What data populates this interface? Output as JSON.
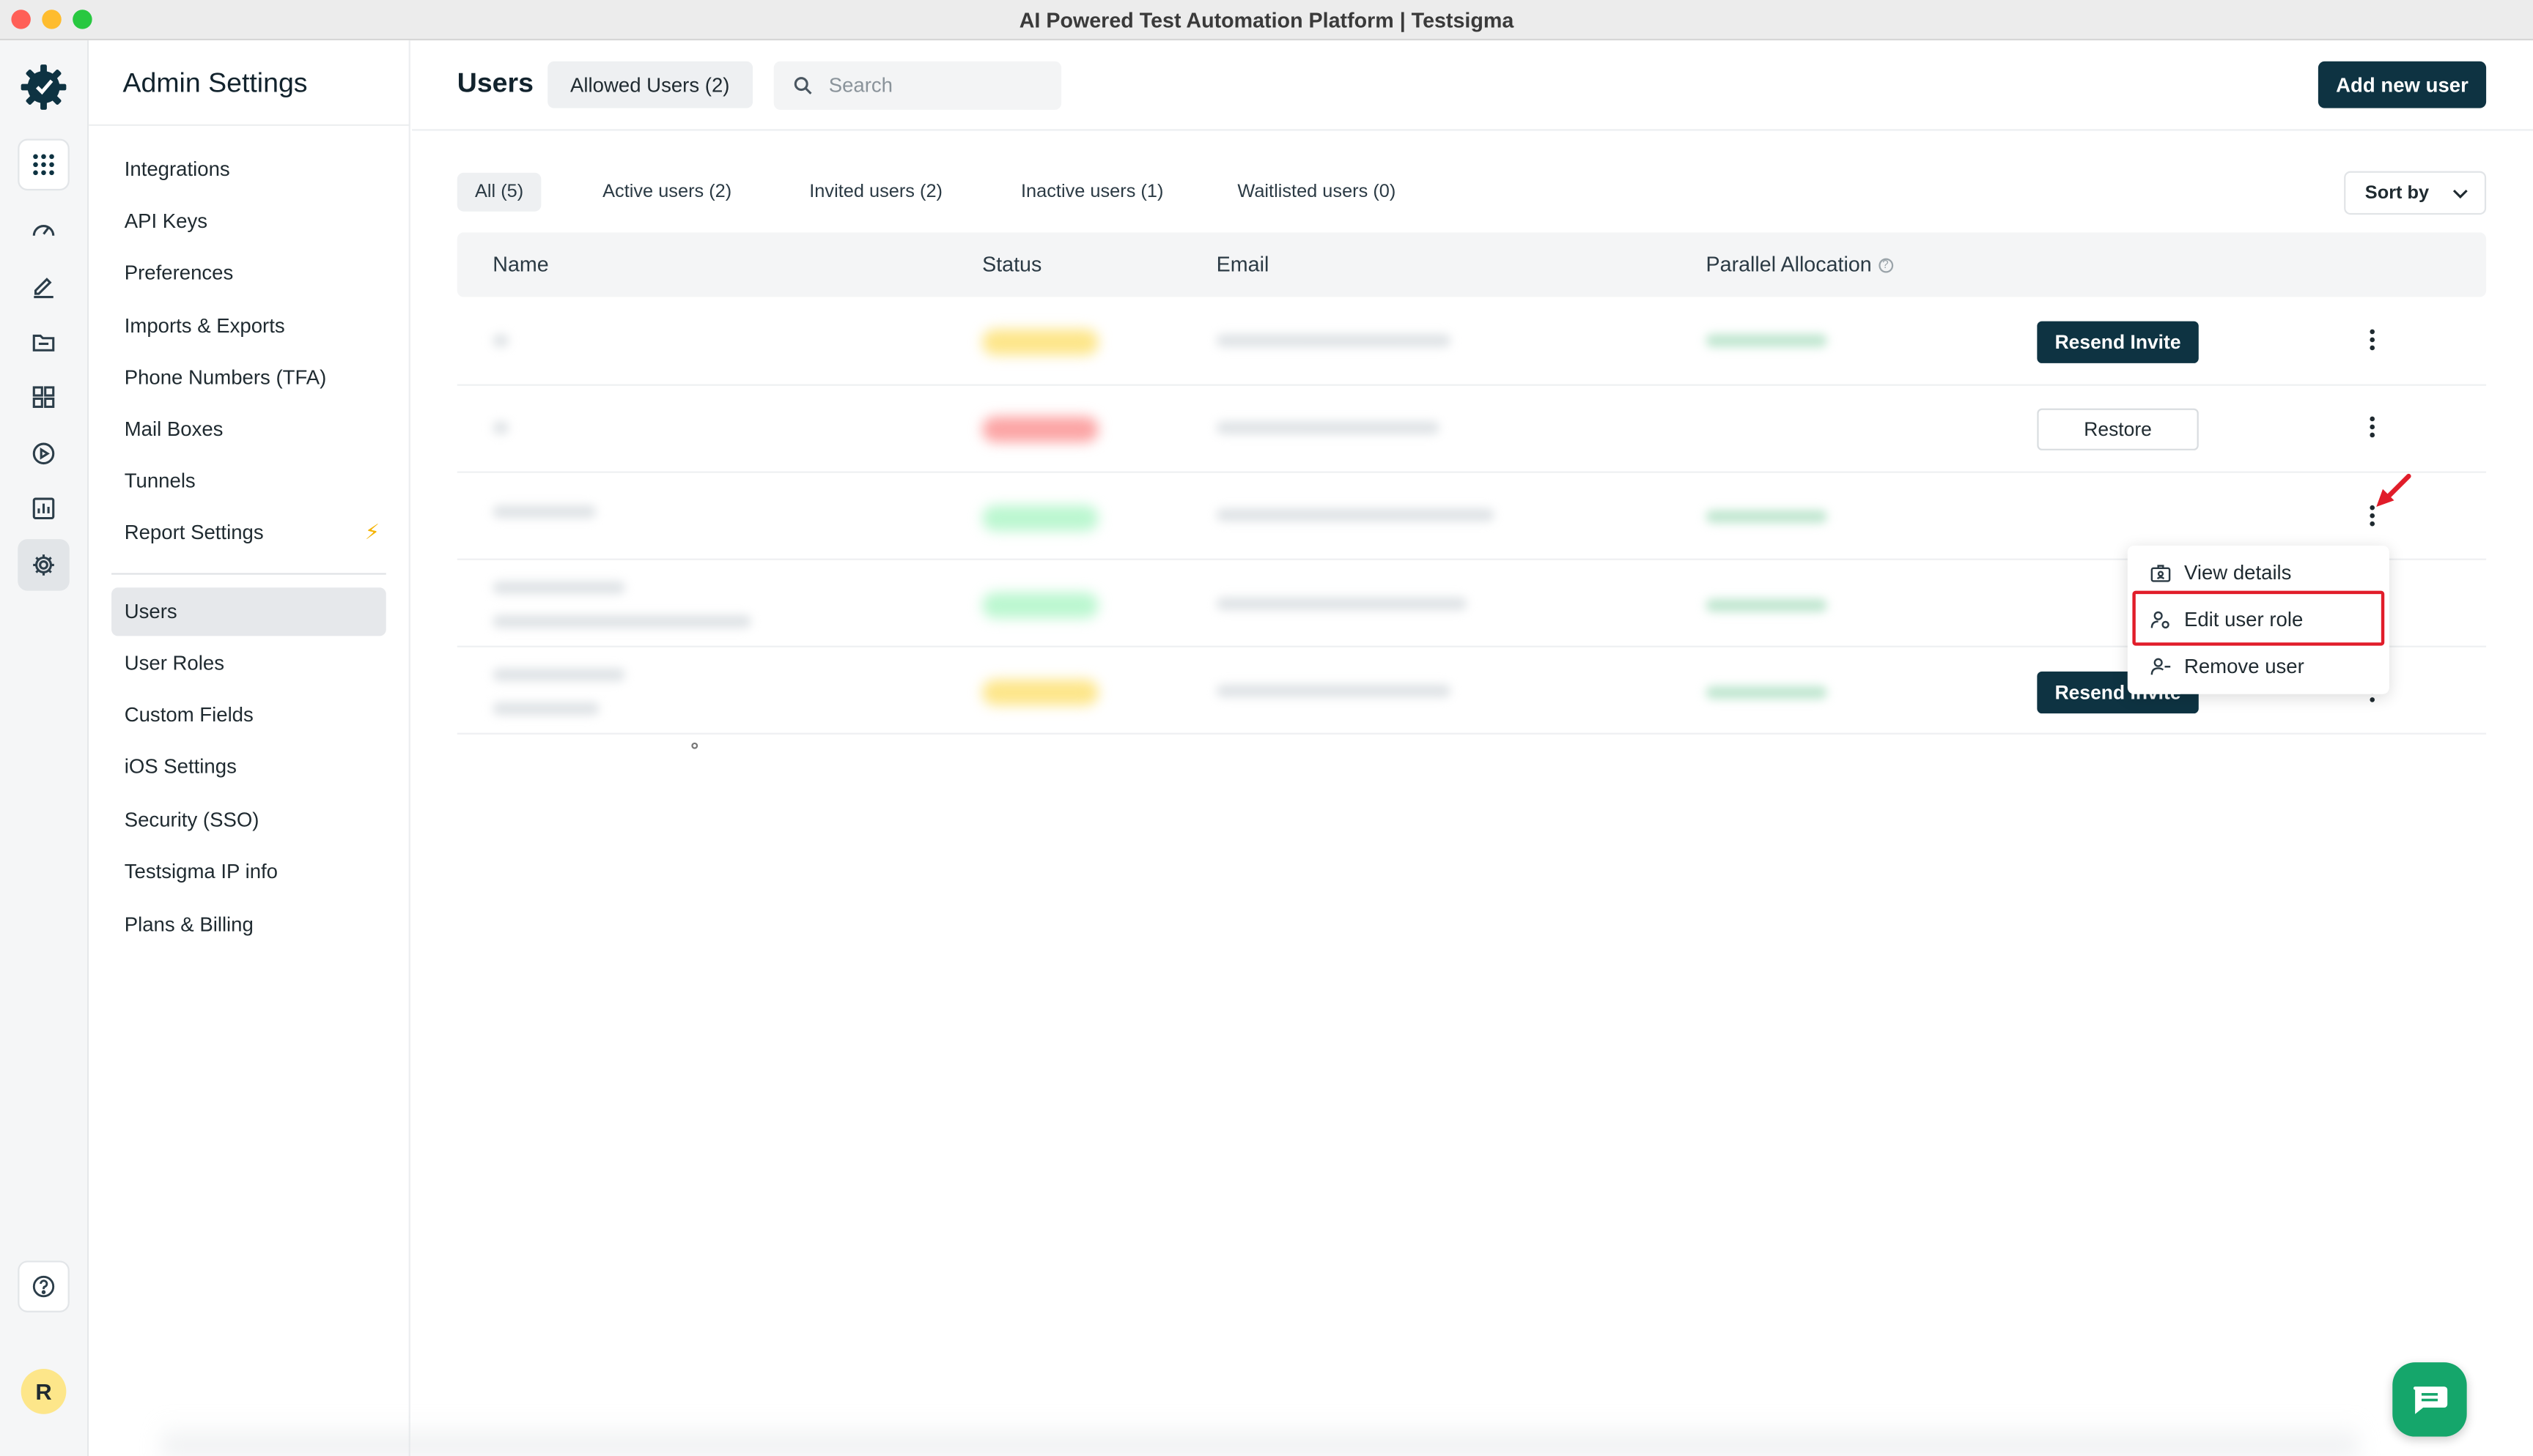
{
  "window": {
    "title": "AI Powered Test Automation Platform | Testsigma"
  },
  "rail": {
    "icons": [
      "apps-grid-icon",
      "dashboard-icon",
      "edit-icon",
      "folder-icon",
      "modules-icon",
      "run-icon",
      "reports-icon",
      "settings-icon",
      "help-icon"
    ],
    "avatar_initial": "R"
  },
  "sidebar": {
    "title": "Admin Settings",
    "items": [
      {
        "label": "Integrations"
      },
      {
        "label": "API Keys"
      },
      {
        "label": "Preferences"
      },
      {
        "label": "Imports & Exports"
      },
      {
        "label": "Phone Numbers (TFA)"
      },
      {
        "label": "Mail Boxes"
      },
      {
        "label": "Tunnels"
      },
      {
        "label": "Report Settings"
      },
      {
        "label": "Users"
      },
      {
        "label": "User Roles"
      },
      {
        "label": "Custom Fields"
      },
      {
        "label": "iOS Settings"
      },
      {
        "label": "Security (SSO)"
      },
      {
        "label": "Testsigma IP info"
      },
      {
        "label": "Plans & Billing"
      }
    ],
    "active": "Users"
  },
  "header": {
    "title": "Users",
    "allowed_badge": "Allowed Users (2)",
    "search_placeholder": "Search",
    "add_button": "Add new user"
  },
  "filters": {
    "tabs": [
      {
        "label": "All (5)"
      },
      {
        "label": "Active users (2)"
      },
      {
        "label": "Invited users (2)"
      },
      {
        "label": "Inactive users (1)"
      },
      {
        "label": "Waitlisted users (0)"
      }
    ],
    "active": "All (5)",
    "sort_label": "Sort by"
  },
  "table": {
    "columns": [
      "Name",
      "Status",
      "Email",
      "Parallel Allocation"
    ],
    "rows": [
      {
        "status_color": "yellow",
        "action": "Resend Invite"
      },
      {
        "status_color": "red",
        "action": "Restore"
      },
      {
        "status_color": "green",
        "action": ""
      },
      {
        "status_color": "green",
        "action": ""
      },
      {
        "status_color": "yellow",
        "action": "Resend Invite"
      }
    ]
  },
  "context_menu": {
    "items": [
      {
        "label": "View details",
        "icon": "id-card-icon"
      },
      {
        "label": "Edit user role",
        "icon": "user-role-icon"
      },
      {
        "label": "Remove user",
        "icon": "user-minus-icon"
      }
    ],
    "highlighted": "Edit user role"
  },
  "colors": {
    "primary": "#0e3342",
    "highlight": "#e11d2a",
    "chat": "#15a66b"
  }
}
